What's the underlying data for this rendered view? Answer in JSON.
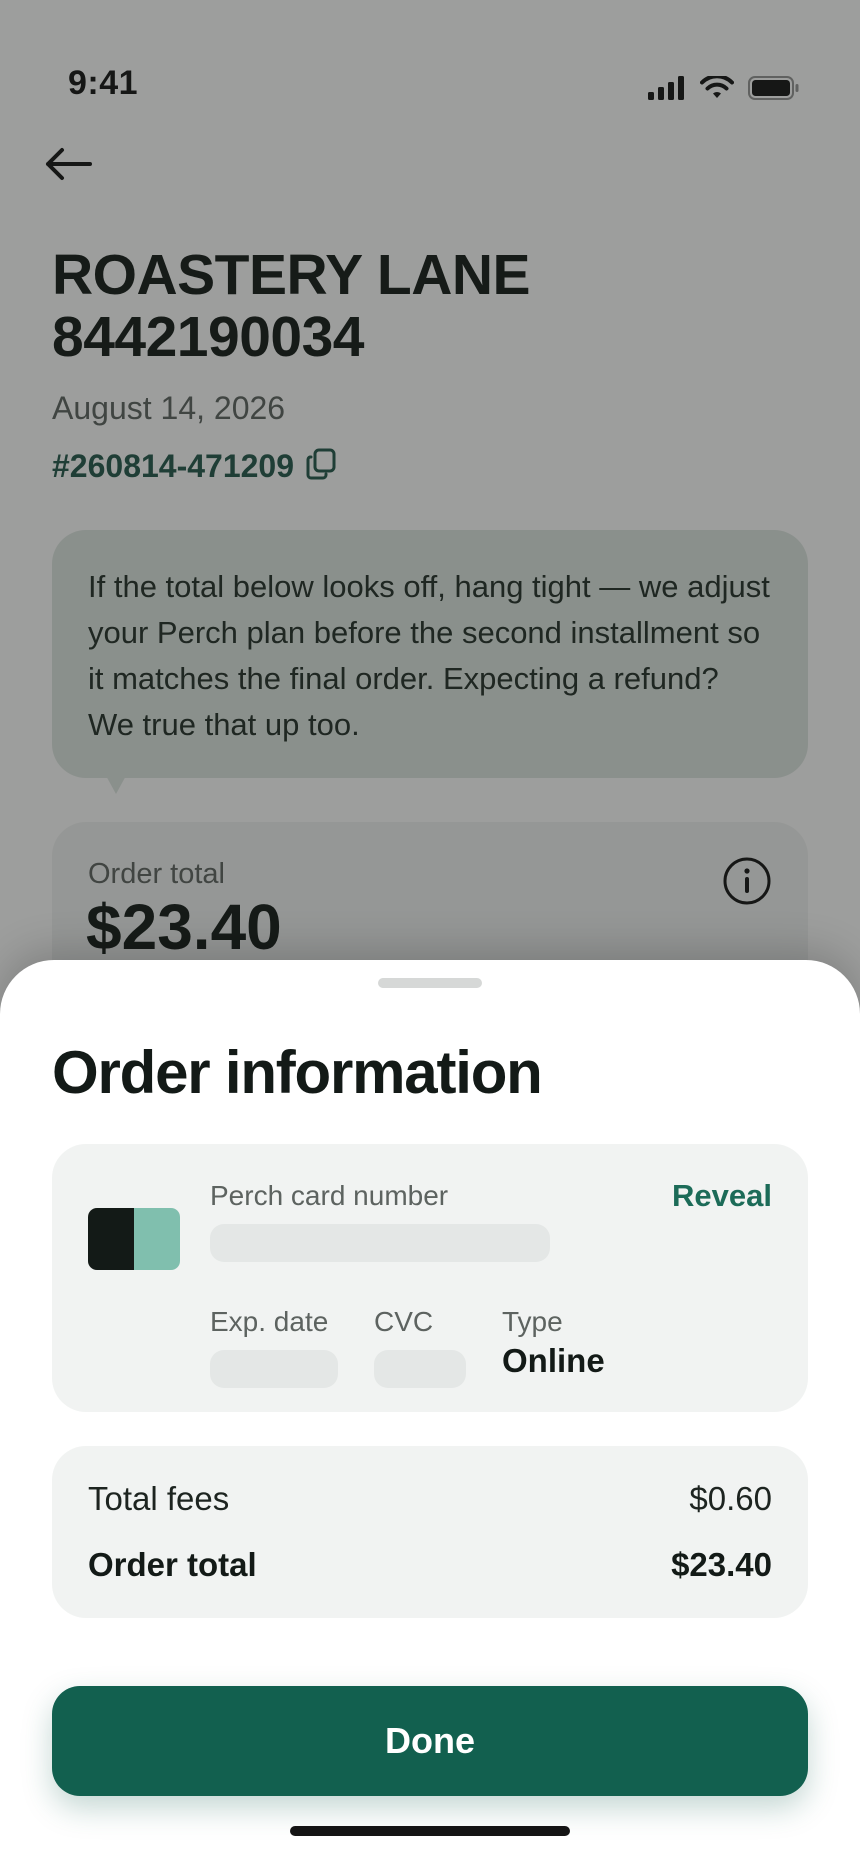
{
  "status_bar": {
    "time": "9:41"
  },
  "order": {
    "merchant": "ROASTERY LANE 8442190034",
    "date": "August 14, 2026",
    "order_id": "#260814-471209",
    "note": "If the total below looks off, hang tight — we adjust your Perch plan before the second installment so it matches the final order. Expecting a refund? We true that up too.",
    "total_label": "Order total",
    "total_value": "$23.40"
  },
  "sheet": {
    "title": "Order information",
    "card": {
      "number_label": "Perch card number",
      "reveal_label": "Reveal",
      "exp_label": "Exp. date",
      "cvc_label": "CVC",
      "type_label": "Type",
      "type_value": "Online"
    },
    "fees": {
      "fees_label": "Total fees",
      "fees_value": "$0.60",
      "total_label": "Order total",
      "total_value": "$23.40"
    },
    "done_label": "Done"
  },
  "colors": {
    "accent": "#12604f",
    "link": "#1c6b58",
    "card_dark": "#131a17",
    "card_light": "#80bfae"
  },
  "icons": [
    "signal-icon",
    "wifi-icon",
    "battery-icon",
    "back-arrow-icon",
    "copy-icon",
    "info-icon"
  ]
}
